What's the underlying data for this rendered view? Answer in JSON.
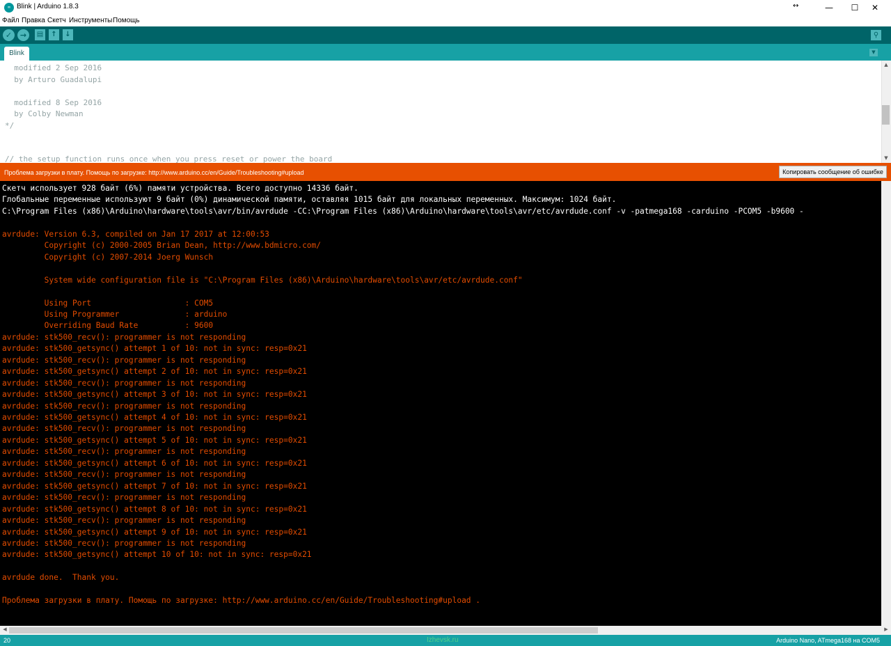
{
  "window": {
    "title": "Blink | Arduino 1.8.3",
    "icon": "arduino-icon",
    "minimize": "—",
    "maximize": "☐",
    "close": "✕",
    "resize": "↔"
  },
  "menu": {
    "items": [
      "Файл",
      "Правка",
      "Скетч",
      "Инструменты",
      "Помощь"
    ]
  },
  "toolbar": {
    "verify": "✓",
    "upload": "→",
    "new": "▤",
    "open": "↑",
    "save": "↓",
    "serial_monitor": "⚲"
  },
  "tabs": {
    "items": [
      {
        "label": "Blink"
      }
    ],
    "menu": "▼"
  },
  "editor": {
    "lines": [
      "  modified 2 Sep 2016",
      "  by Arturo Guadalupi",
      "",
      "  modified 8 Sep 2016",
      "  by Colby Newman",
      "*/",
      "",
      "",
      "// the setup function runs once when you press reset or power the board"
    ]
  },
  "status": {
    "error_message": "Проблема загрузки в плату. Помощь по загрузке: http://www.arduino.cc/en/Guide/Troubleshooting#upload",
    "copy_button": "Копировать сообщение об ошибке"
  },
  "console": {
    "lines": [
      {
        "text": "Скетч использует 928 байт (6%) памяти устройства. Всего доступно 14336 байт.",
        "color": "white"
      },
      {
        "text": "Глобальные переменные используют 9 байт (0%) динамической памяти, оставляя 1015 байт для локальных переменных. Максимум: 1024 байт.",
        "color": "white"
      },
      {
        "text": "C:\\Program Files (x86)\\Arduino\\hardware\\tools\\avr/bin/avrdude -CC:\\Program Files (x86)\\Arduino\\hardware\\tools\\avr/etc/avrdude.conf -v -patmega168 -carduino -PCOM5 -b9600 -",
        "color": "white"
      },
      {
        "text": "",
        "color": "white"
      },
      {
        "text": "avrdude: Version 6.3, compiled on Jan 17 2017 at 12:00:53",
        "color": "orange"
      },
      {
        "text": "         Copyright (c) 2000-2005 Brian Dean, http://www.bdmicro.com/",
        "color": "orange"
      },
      {
        "text": "         Copyright (c) 2007-2014 Joerg Wunsch",
        "color": "orange"
      },
      {
        "text": "",
        "color": "orange"
      },
      {
        "text": "         System wide configuration file is \"C:\\Program Files (x86)\\Arduino\\hardware\\tools\\avr/etc/avrdude.conf\"",
        "color": "orange"
      },
      {
        "text": "",
        "color": "orange"
      },
      {
        "text": "         Using Port                    : COM5",
        "color": "orange"
      },
      {
        "text": "         Using Programmer              : arduino",
        "color": "orange"
      },
      {
        "text": "         Overriding Baud Rate          : 9600",
        "color": "orange"
      },
      {
        "text": "avrdude: stk500_recv(): programmer is not responding",
        "color": "orange"
      },
      {
        "text": "avrdude: stk500_getsync() attempt 1 of 10: not in sync: resp=0x21",
        "color": "orange"
      },
      {
        "text": "avrdude: stk500_recv(): programmer is not responding",
        "color": "orange"
      },
      {
        "text": "avrdude: stk500_getsync() attempt 2 of 10: not in sync: resp=0x21",
        "color": "orange"
      },
      {
        "text": "avrdude: stk500_recv(): programmer is not responding",
        "color": "orange"
      },
      {
        "text": "avrdude: stk500_getsync() attempt 3 of 10: not in sync: resp=0x21",
        "color": "orange"
      },
      {
        "text": "avrdude: stk500_recv(): programmer is not responding",
        "color": "orange"
      },
      {
        "text": "avrdude: stk500_getsync() attempt 4 of 10: not in sync: resp=0x21",
        "color": "orange"
      },
      {
        "text": "avrdude: stk500_recv(): programmer is not responding",
        "color": "orange"
      },
      {
        "text": "avrdude: stk500_getsync() attempt 5 of 10: not in sync: resp=0x21",
        "color": "orange"
      },
      {
        "text": "avrdude: stk500_recv(): programmer is not responding",
        "color": "orange"
      },
      {
        "text": "avrdude: stk500_getsync() attempt 6 of 10: not in sync: resp=0x21",
        "color": "orange"
      },
      {
        "text": "avrdude: stk500_recv(): programmer is not responding",
        "color": "orange"
      },
      {
        "text": "avrdude: stk500_getsync() attempt 7 of 10: not in sync: resp=0x21",
        "color": "orange"
      },
      {
        "text": "avrdude: stk500_recv(): programmer is not responding",
        "color": "orange"
      },
      {
        "text": "avrdude: stk500_getsync() attempt 8 of 10: not in sync: resp=0x21",
        "color": "orange"
      },
      {
        "text": "avrdude: stk500_recv(): programmer is not responding",
        "color": "orange"
      },
      {
        "text": "avrdude: stk500_getsync() attempt 9 of 10: not in sync: resp=0x21",
        "color": "orange"
      },
      {
        "text": "avrdude: stk500_recv(): programmer is not responding",
        "color": "orange"
      },
      {
        "text": "avrdude: stk500_getsync() attempt 10 of 10: not in sync: resp=0x21",
        "color": "orange"
      },
      {
        "text": "",
        "color": "orange"
      },
      {
        "text": "avrdude done.  Thank you.",
        "color": "orange"
      },
      {
        "text": "",
        "color": "orange"
      },
      {
        "text": "Проблема загрузки в плату. Помощь по загрузке: http://www.arduino.cc/en/Guide/Troubleshooting#upload .",
        "color": "orange"
      }
    ]
  },
  "statusbar": {
    "line_number": "20",
    "watermark": "Izhevsk.ru",
    "board": "Arduino Nano, ATmega168 на COM5"
  },
  "colors": {
    "toolbar": "#006468",
    "tabbar": "#17a1a5",
    "errorbar": "#e75001",
    "console_error": "#e34c00"
  }
}
